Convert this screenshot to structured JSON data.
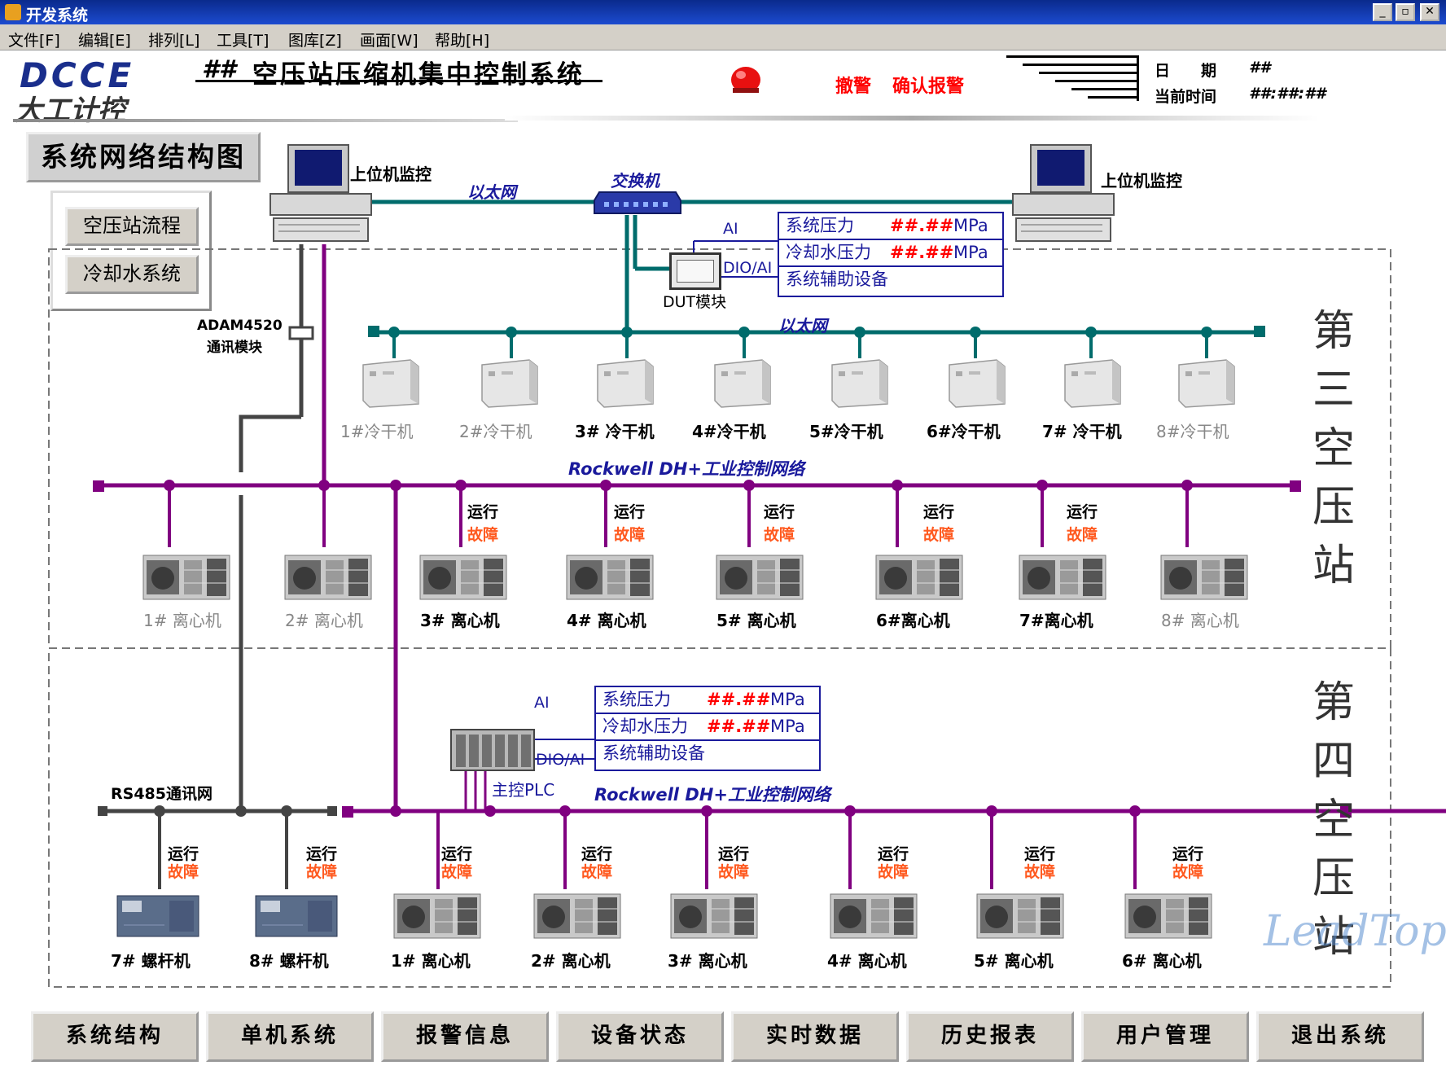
{
  "window": {
    "title": "开发系统",
    "controls": [
      "_",
      "▫",
      "✕"
    ]
  },
  "menu": [
    "文件[F]",
    "编辑[E]",
    "排列[L]",
    "工具[T]",
    "图库[Z]",
    "画面[W]",
    "帮助[H]"
  ],
  "header": {
    "logo_top": "DCCE",
    "logo_bottom": "大工计控",
    "title_prefix": "##",
    "title": "空压站压缩机集中控制系统",
    "alarm_labels": [
      "撤警",
      "确认报警"
    ],
    "date_label": "日　　期",
    "date_value": "##",
    "time_label": "当前时间",
    "time_value": "##:##:##"
  },
  "page_title": "系统网络结构图",
  "side_buttons": [
    "空压站流程",
    "冷却水系统"
  ],
  "network": {
    "host_monitor": "上位机监控",
    "ethernet": "以太网",
    "switch": "交换机",
    "dut": "DUT模块",
    "ai": "AI",
    "dio_ai": "DIO/AI",
    "adam_l1": "ADAM4520",
    "adam_l2": "通讯模块",
    "rs485": "RS485通讯网",
    "rockwell": "Rockwell DH+工业控制网络",
    "main_plc": "主控PLC"
  },
  "info_rows": [
    {
      "label": "系统压力",
      "value": "##.##",
      "unit": "MPa"
    },
    {
      "label": "冷却水压力",
      "value": "##.##",
      "unit": "MPa"
    },
    {
      "label": "系统辅助设备",
      "value": "",
      "unit": ""
    }
  ],
  "station3_label": [
    "第",
    "三",
    "空",
    "压",
    "站"
  ],
  "station4_label": [
    "第",
    "四",
    "空",
    "压",
    "站"
  ],
  "dryers": [
    "1#冷干机",
    "2#冷干机",
    "3# 冷干机",
    "4#冷干机",
    "5#冷干机",
    "6#冷干机",
    "7# 冷干机",
    "8#冷干机"
  ],
  "dryers_active": [
    false,
    false,
    true,
    true,
    true,
    true,
    true,
    false
  ],
  "station3_centrifugals": [
    "1# 离心机",
    "2# 离心机",
    "3# 离心机",
    "4# 离心机",
    "5# 离心机",
    "6#离心机",
    "7#离心机",
    "8# 离心机"
  ],
  "station3_active": [
    false,
    false,
    true,
    true,
    true,
    true,
    true,
    false
  ],
  "station4_screws": [
    "7# 螺杆机",
    "8# 螺杆机"
  ],
  "station4_centrifugals": [
    "1# 离心机",
    "2# 离心机",
    "3# 离心机",
    "4# 离心机",
    "5# 离心机",
    "6# 离心机"
  ],
  "status": {
    "run": "运行",
    "fault": "故障"
  },
  "nav": [
    "系统结构",
    "单机系统",
    "报警信息",
    "设备状态",
    "实时数据",
    "历史报表",
    "用户管理",
    "退出系统"
  ],
  "watermark": "LeadTop",
  "colors": {
    "purple": "#800080",
    "teal": "#006c6c",
    "navy": "#1a1a9c",
    "fault": "#ff5a20",
    "alarm": "#ff0000"
  }
}
